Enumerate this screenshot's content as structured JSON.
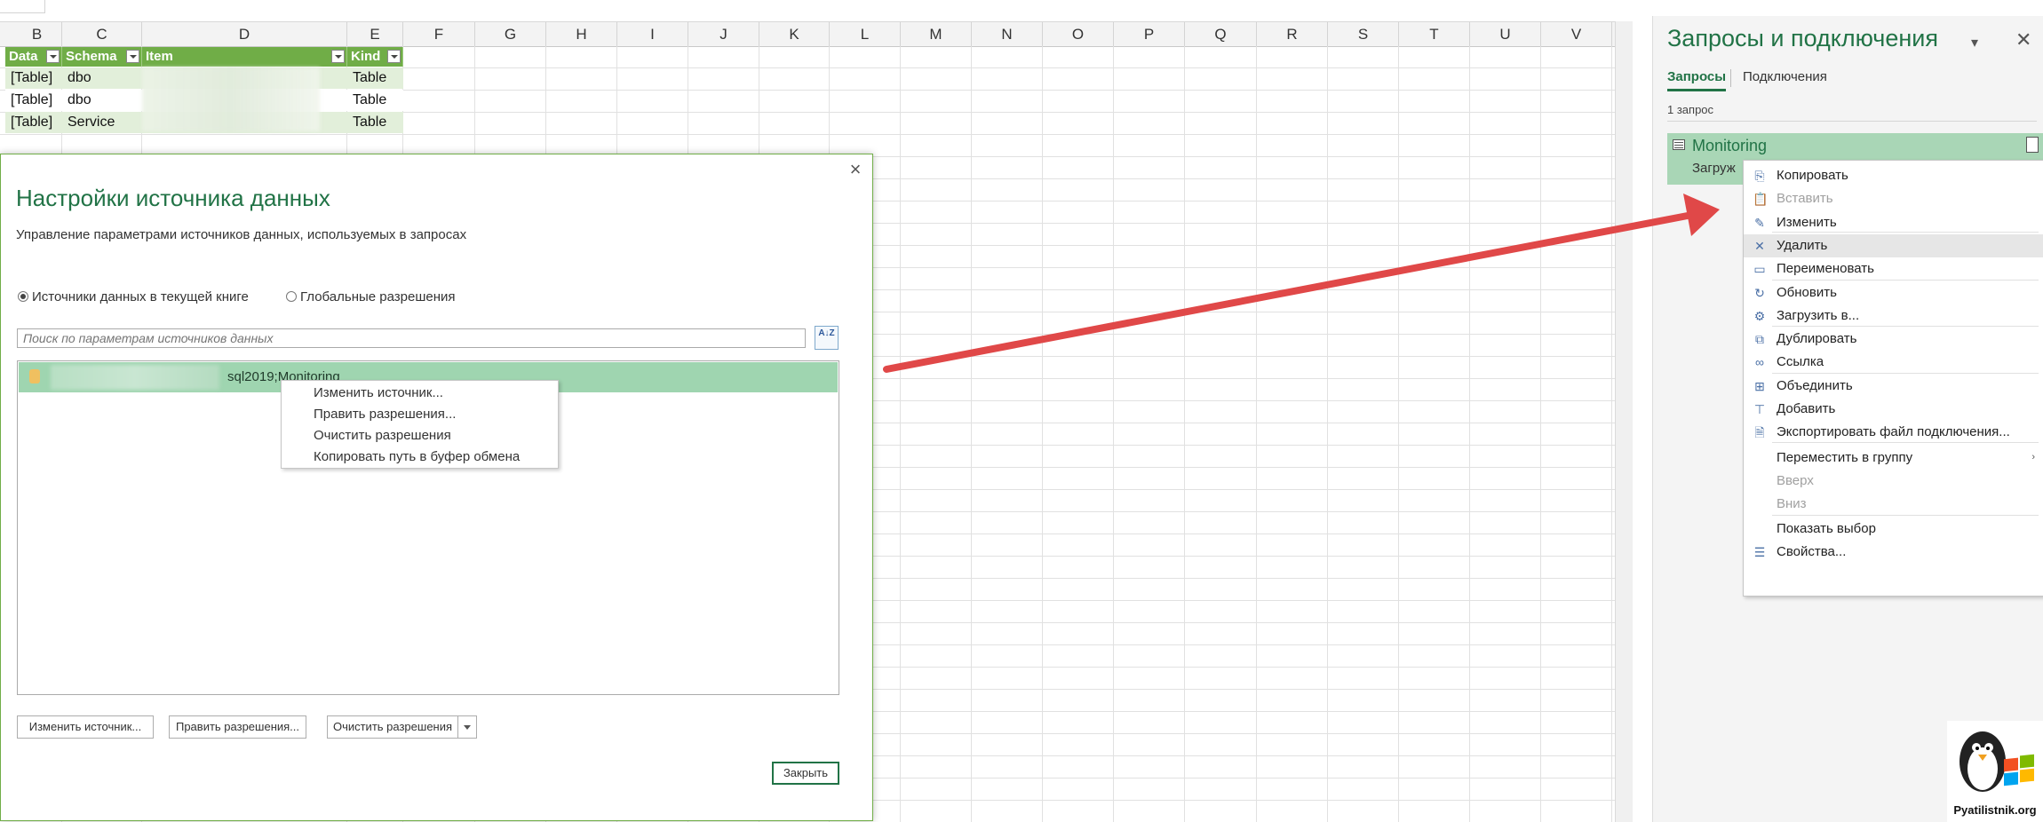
{
  "sheet": {
    "columns": [
      "B",
      "C",
      "D",
      "E",
      "F",
      "G",
      "H",
      "I",
      "J",
      "K",
      "L",
      "M",
      "N",
      "O",
      "P",
      "Q",
      "R",
      "S",
      "T",
      "U",
      "V"
    ],
    "table": {
      "headers": [
        "Data",
        "Schema",
        "Item",
        "Kind"
      ],
      "rows": [
        [
          "[Table]",
          "dbo",
          "",
          "Table"
        ],
        [
          "[Table]",
          "dbo",
          "",
          "Table"
        ],
        [
          "[Table]",
          "Service",
          "",
          "Table"
        ]
      ]
    }
  },
  "dialog": {
    "title": "Настройки источника данных",
    "subtitle": "Управление параметрами источников данных, используемых в запросах",
    "radio_current": "Источники данных в текущей книге",
    "radio_global": "Глобальные разрешения",
    "search_placeholder": "Поиск по параметрам источников данных",
    "sort_icon_text": "A↓Z",
    "item_text": "sql2019;Monitoring",
    "context_menu": [
      "Изменить источник...",
      "Править разрешения...",
      "Очистить разрешения",
      "Копировать путь в буфер обмена"
    ],
    "btn_change": "Изменить источник...",
    "btn_edit": "Править разрешения...",
    "btn_clear": "Очистить разрешения",
    "btn_close": "Закрыть"
  },
  "panel": {
    "title": "Запросы и подключения",
    "tab_queries": "Запросы",
    "tab_connections": "Подключения",
    "count": "1 запрос",
    "query_name": "Monitoring",
    "query_status": "Загруж"
  },
  "panel_menu": [
    {
      "label": "Копировать",
      "icon": "copy-icon",
      "glyph": "⎘",
      "disabled": false
    },
    {
      "label": "Вставить",
      "icon": "paste-icon",
      "glyph": "📋",
      "disabled": true
    },
    {
      "label": "Изменить",
      "icon": "edit-icon",
      "glyph": "✎",
      "disabled": false
    },
    {
      "label": "Удалить",
      "icon": "delete-icon",
      "glyph": "✕",
      "disabled": false,
      "highlight": true
    },
    {
      "label": "Переименовать",
      "icon": "rename-icon",
      "glyph": "▭",
      "disabled": false
    },
    {
      "label": "Обновить",
      "icon": "refresh-icon",
      "glyph": "↻",
      "disabled": false
    },
    {
      "label": "Загрузить в...",
      "icon": "load-to-icon",
      "glyph": "⚙",
      "disabled": false
    },
    {
      "label": "Дублировать",
      "icon": "duplicate-icon",
      "glyph": "⧉",
      "disabled": false
    },
    {
      "label": "Ссылка",
      "icon": "reference-icon",
      "glyph": "∞",
      "disabled": false
    },
    {
      "label": "Объединить",
      "icon": "merge-icon",
      "glyph": "⊞",
      "disabled": false
    },
    {
      "label": "Добавить",
      "icon": "append-icon",
      "glyph": "⊤",
      "disabled": false
    },
    {
      "label": "Экспортировать файл подключения...",
      "icon": "export-icon",
      "glyph": "🗎",
      "disabled": false
    },
    {
      "label": "Переместить в группу",
      "icon": "",
      "glyph": "",
      "disabled": false,
      "submenu": true
    },
    {
      "label": "Вверх",
      "icon": "",
      "glyph": "",
      "disabled": true
    },
    {
      "label": "Вниз",
      "icon": "",
      "glyph": "",
      "disabled": true
    },
    {
      "label": "Показать выбор",
      "icon": "",
      "glyph": "",
      "disabled": false
    },
    {
      "label": "Свойства...",
      "icon": "properties-icon",
      "glyph": "☰",
      "disabled": false
    }
  ],
  "logo": {
    "text": "Pyatilistnik.org"
  },
  "colors": {
    "accent": "#217346",
    "table_header": "#70ad47",
    "selection": "#a9d6b6",
    "arrow": "#e04848"
  }
}
